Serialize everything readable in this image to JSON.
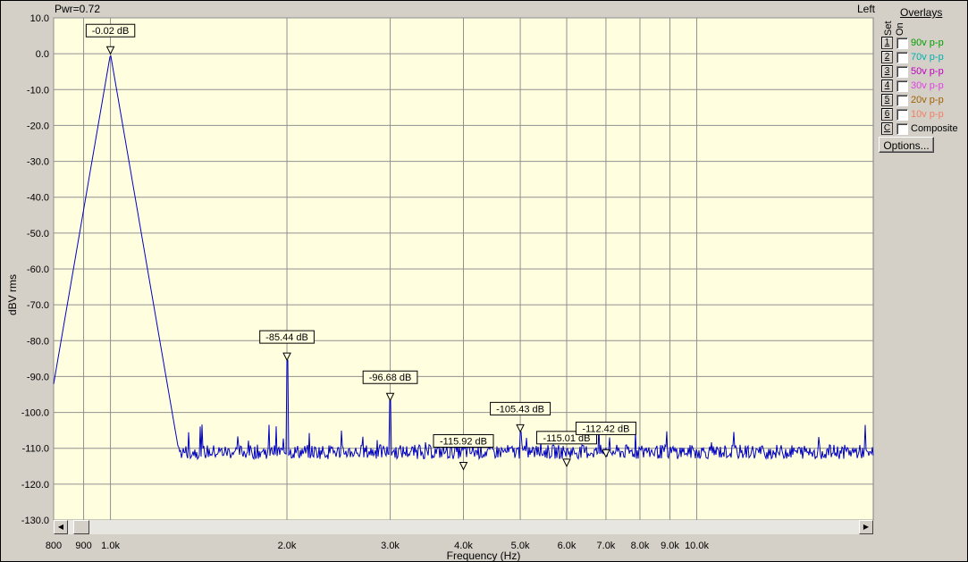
{
  "header": {
    "pwr_text": "Pwr=0.72",
    "channel": "Left"
  },
  "overlays": {
    "title": "Overlays",
    "set_label": "Set",
    "on_label": "On",
    "rows": [
      {
        "num": "1",
        "label": "90v p-p",
        "color": "#00a000"
      },
      {
        "num": "2",
        "label": "70v p-p",
        "color": "#00b0b0"
      },
      {
        "num": "3",
        "label": "50v p-p",
        "color": "#c000c0"
      },
      {
        "num": "4",
        "label": "30v p-p",
        "color": "#e040e0"
      },
      {
        "num": "5",
        "label": "20v p-p",
        "color": "#a06000"
      },
      {
        "num": "6",
        "label": "10v p-p",
        "color": "#f08060"
      },
      {
        "num": "C",
        "label": "Composite",
        "color": "#000000"
      }
    ],
    "options_label": "Options..."
  },
  "chart_data": {
    "type": "line",
    "xlabel": "Frequency (Hz)",
    "ylabel": "dBV rms",
    "xscale": "log",
    "xlim": [
      800,
      20000
    ],
    "ylim": [
      -130,
      10
    ],
    "grid": true,
    "line_color": "#0000c0",
    "background": "#ffffe0",
    "x_ticks": [
      {
        "value": 800,
        "label": "800"
      },
      {
        "value": 900,
        "label": "900"
      },
      {
        "value": 1000,
        "label": "1.0k"
      },
      {
        "value": 2000,
        "label": "2.0k"
      },
      {
        "value": 3000,
        "label": "3.0k"
      },
      {
        "value": 4000,
        "label": "4.0k"
      },
      {
        "value": 5000,
        "label": "5.0k"
      },
      {
        "value": 6000,
        "label": "6.0k"
      },
      {
        "value": 7000,
        "label": "7.0k"
      },
      {
        "value": 8000,
        "label": "8.0k"
      },
      {
        "value": 9000,
        "label": "9.0k"
      },
      {
        "value": 10000,
        "label": "10.0k"
      }
    ],
    "y_ticks": [
      10,
      0,
      -10,
      -20,
      -30,
      -40,
      -50,
      -60,
      -70,
      -80,
      -90,
      -100,
      -110,
      -120,
      -130
    ],
    "y_tick_labels": [
      "10.0",
      "0.0",
      "-10.0",
      "-20.0",
      "-30.0",
      "-40.0",
      "-50.0",
      "-60.0",
      "-70.0",
      "-80.0",
      "-90.0",
      "-100.0",
      "-110.0",
      "-120.0",
      "-130.0"
    ],
    "noise_floor": -111,
    "peaks": [
      {
        "x": 1000,
        "y": -0.02,
        "label": "-0.02 dB"
      },
      {
        "x": 2000,
        "y": -85.44,
        "label": "-85.44 dB"
      },
      {
        "x": 3000,
        "y": -96.68,
        "label": "-96.68 dB"
      },
      {
        "x": 4000,
        "y": -115.92,
        "label": "-115.92 dB"
      },
      {
        "x": 5000,
        "y": -105.43,
        "label": "-105.43 dB"
      },
      {
        "x": 6000,
        "y": -115.01,
        "label": "-115.01 dB"
      },
      {
        "x": 7000,
        "y": -112.42,
        "label": "-112.42 dB"
      }
    ]
  }
}
